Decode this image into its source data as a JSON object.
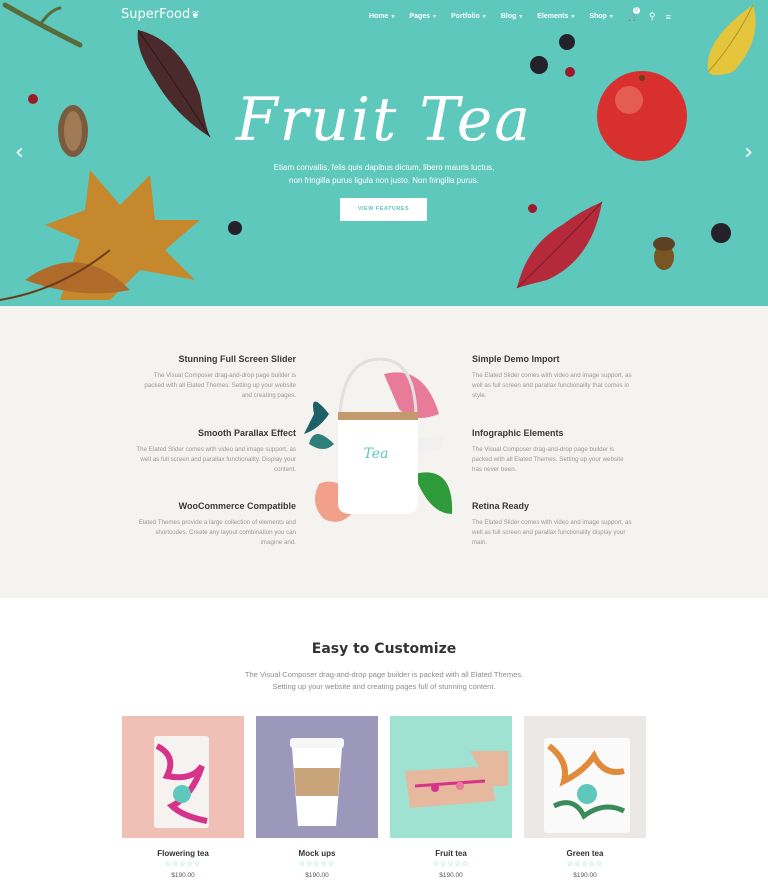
{
  "header": {
    "logo": "SuperFood",
    "nav": [
      {
        "label": "Home",
        "has_caret": true
      },
      {
        "label": "Pages",
        "has_caret": true
      },
      {
        "label": "Portfolio",
        "has_caret": true
      },
      {
        "label": "Blog",
        "has_caret": true
      },
      {
        "label": "Elements",
        "has_caret": true
      },
      {
        "label": "Shop",
        "has_caret": true
      }
    ],
    "icons": [
      "cart-icon",
      "search-icon",
      "menu-icon"
    ],
    "cart_count": "0"
  },
  "hero": {
    "title": "Fruit Tea",
    "subtitle_line1": "Etiam convallis, felis quis dapibus dictum, libero mauris luctus,",
    "subtitle_line2": "non fringilla purus ligula non justo. Non fringilla purus.",
    "button": "VIEW FEATURES",
    "bg_color": "#5ec8bd"
  },
  "features": {
    "left": [
      {
        "title": "Stunning Full Screen Slider",
        "text": "The Visual Composer drag-and-drop page builder is packed with all Elated Themes. Setting up your website and creating pages."
      },
      {
        "title": "Smooth Parallax Effect",
        "text": "The Elated Slider comes with video and image support, as well as full screen and parallax functionality. Display your content."
      },
      {
        "title": "WooCommerce Compatible",
        "text": "Elated Themes provide a large collection of elements and shortcodes. Create any layout combination you can imagine and."
      }
    ],
    "right": [
      {
        "title": "Simple Demo Import",
        "text": "The Elated Slider comes with video and image support, as well as full screen and parallax functionality that comes in style."
      },
      {
        "title": "Infographic Elements",
        "text": "The Visual Composer drag-and-drop page builder is packed with all Elated Themes. Setting up your website has never been."
      },
      {
        "title": "Retina Ready",
        "text": "The Elated Slider comes with video and image support, as well as full screen and parallax functionality display your main."
      }
    ],
    "kettle_label": "Tea"
  },
  "customize": {
    "title": "Easy to Customize",
    "subtitle_line1": "The Visual Composer drag-and-drop page builder is packed with all Elated Themes.",
    "subtitle_line2": "Setting up your website and creating pages full of stunning content."
  },
  "products": [
    {
      "name": "Flowering tea",
      "price": "$190.00",
      "bg": "#f0bfb5",
      "rating": 5
    },
    {
      "name": "Mock ups",
      "price": "$190.00",
      "bg": "#9b98bc",
      "rating": 4
    },
    {
      "name": "Fruit tea",
      "price": "$190.00",
      "bg": "#9fe2d2",
      "rating": 5
    },
    {
      "name": "Green tea",
      "price": "$190.00",
      "bg": "#ece8e6",
      "rating": 3
    }
  ]
}
